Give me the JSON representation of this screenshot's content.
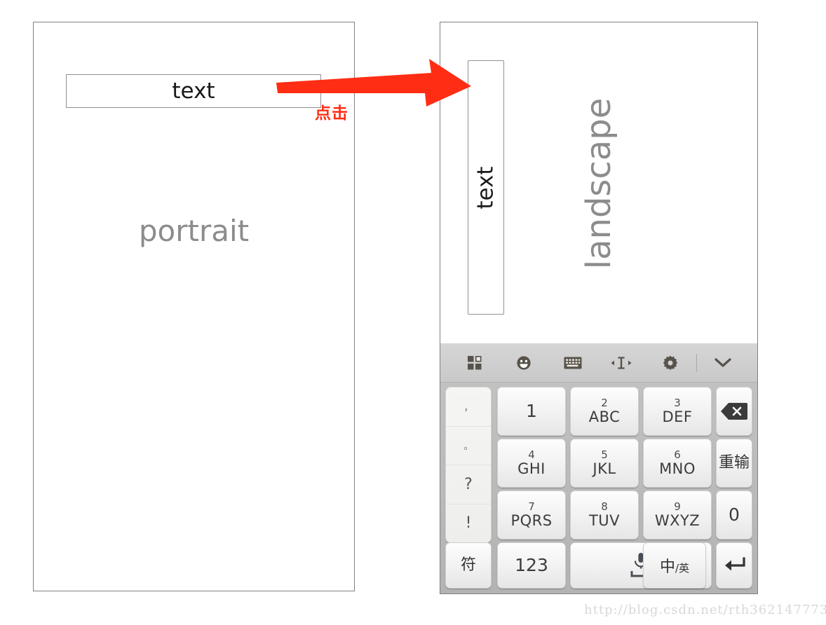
{
  "portrait": {
    "textfield_value": "text",
    "textfield_placeholder": "text",
    "label": "portrait"
  },
  "landscape": {
    "textfield_value": "text",
    "textfield_placeholder": "text",
    "label": "landscape"
  },
  "annotation": {
    "label": "点击",
    "color": "#ff2d14",
    "arrow": "right-arrow"
  },
  "keyboard": {
    "toolbar": [
      {
        "icon": "apps-grid-icon",
        "label": ""
      },
      {
        "icon": "emoji-smiley-icon",
        "label": ""
      },
      {
        "icon": "keyboard-icon",
        "label": ""
      },
      {
        "icon": "cursor-move-icon",
        "label": ""
      },
      {
        "icon": "gear-icon",
        "label": ""
      },
      {
        "icon": "chevron-down-icon",
        "label": ""
      }
    ],
    "punctuation": [
      "，",
      "。",
      "?",
      "!"
    ],
    "keys": [
      {
        "name": "key-1",
        "digit": "1",
        "letters": ""
      },
      {
        "name": "key-2",
        "digit": "2",
        "letters": "ABC"
      },
      {
        "name": "key-3",
        "digit": "3",
        "letters": "DEF"
      },
      {
        "name": "key-backspace",
        "digit": "",
        "letters": "",
        "icon": "backspace-icon"
      },
      {
        "name": "key-4",
        "digit": "4",
        "letters": "GHI"
      },
      {
        "name": "key-5",
        "digit": "5",
        "letters": "JKL"
      },
      {
        "name": "key-6",
        "digit": "6",
        "letters": "MNO"
      },
      {
        "name": "key-reinput",
        "digit": "",
        "letters": "",
        "cn": "重输"
      },
      {
        "name": "key-7",
        "digit": "7",
        "letters": "PQRS"
      },
      {
        "name": "key-8",
        "digit": "8",
        "letters": "TUV"
      },
      {
        "name": "key-9",
        "digit": "9",
        "letters": "WXYZ"
      },
      {
        "name": "key-0",
        "digit": "",
        "letters": "",
        "solo": "0"
      }
    ],
    "bottom_row": [
      {
        "name": "key-symbol",
        "cn": "符"
      },
      {
        "name": "key-123",
        "label": "123"
      },
      {
        "name": "key-space-voice",
        "icon": "microphone-space-icon"
      },
      {
        "name": "key-lang-toggle",
        "cn_main": "中",
        "cn_sep": "/",
        "cn_sub": "英"
      },
      {
        "name": "key-enter",
        "icon": "enter-icon"
      }
    ]
  },
  "watermark": {
    "text": "http://blog.csdn.net/rth362147773"
  }
}
